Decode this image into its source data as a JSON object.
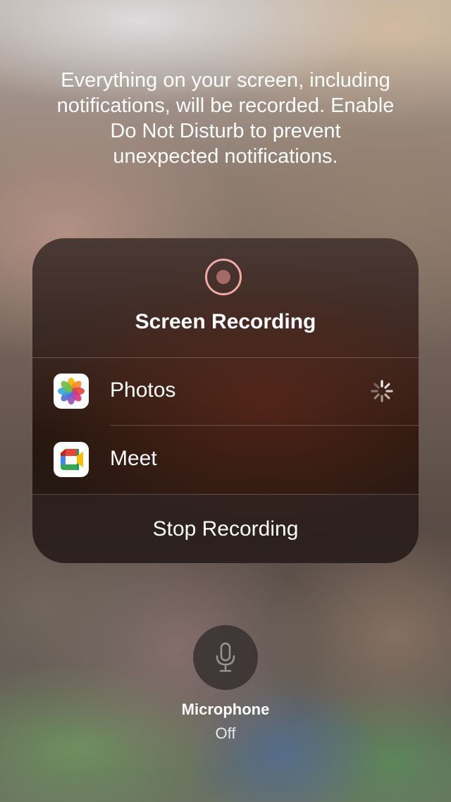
{
  "notice": {
    "line1": "Everything on your screen, including",
    "line2": "notifications, will be recorded. Enable",
    "line3": "Do Not Disturb to prevent",
    "line4": "unexpected notifications."
  },
  "panel": {
    "record_icon": "record-icon",
    "title": "Screen Recording",
    "apps": [
      {
        "label": "Photos",
        "icon": "photos-app-icon",
        "status_icon": "activity-spinner-icon"
      },
      {
        "label": "Meet",
        "icon": "meet-app-icon"
      }
    ],
    "stop_label": "Stop Recording"
  },
  "microphone": {
    "icon": "microphone-icon",
    "title": "Microphone",
    "status": "Off"
  },
  "colors": {
    "record_ring": "#f2a8a4",
    "record_dot": "#a56a66",
    "panel_background": "#2a1a14"
  }
}
